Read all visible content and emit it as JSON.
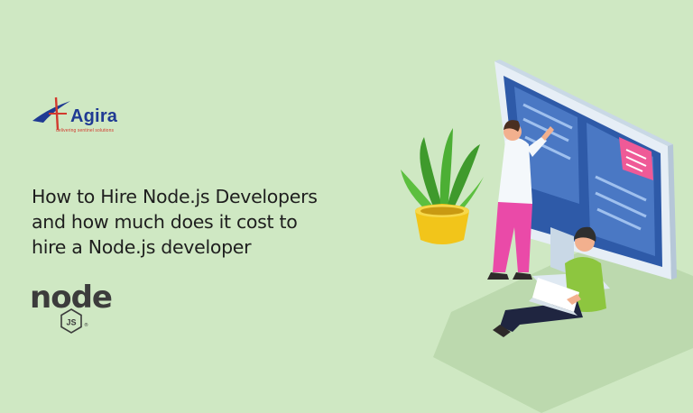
{
  "brand": {
    "name": "Agira",
    "tagline": "delivering sentinel solutions",
    "colors": {
      "primary": "#1f3a93",
      "accent": "#d23a2e"
    }
  },
  "headline": {
    "line1": "How to Hire Node.js Developers",
    "line2": "and how much does it cost to",
    "line3": "hire a Node.js developer"
  },
  "node_logo": {
    "word": "node",
    "badge": "JS",
    "trademark": "®",
    "color": "#3c3c3c"
  },
  "illustration": {
    "icons": [
      "monitor-icon",
      "plant-icon",
      "laptop-icon"
    ],
    "colors": {
      "background": "#cfe8c3",
      "monitor_frame": "#dfe9f2",
      "screen": "#2e5aa8",
      "note": "#ef5a97",
      "pot": "#f2c51a",
      "plant": "#3f9a2c"
    }
  }
}
